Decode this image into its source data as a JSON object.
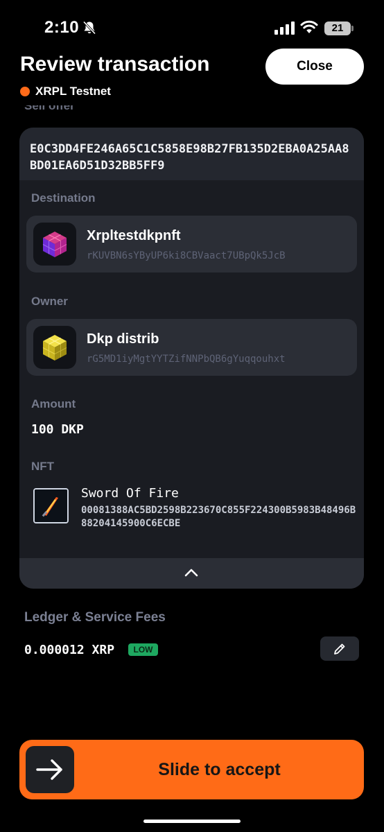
{
  "status_bar": {
    "time": "2:10",
    "battery": "21",
    "icons": [
      "bell-slash-icon",
      "signal-icon",
      "wifi-icon",
      "battery-icon"
    ]
  },
  "header": {
    "title": "Review transaction",
    "network": "XRPL Testnet",
    "network_color": "#ff6b1a",
    "close_label": "Close"
  },
  "sell_offer": {
    "label": "Sell offer",
    "id": "E0C3DD4FE246A65C1C5858E98B27FB135D2EBA0A25AA8BD01EA6D51D32BB5FF9"
  },
  "destination": {
    "label": "Destination",
    "name": "Xrpltestdkpnft",
    "address": "rKUVBN6sYByUP6ki8CBVaact7UBpQk5JcB"
  },
  "owner": {
    "label": "Owner",
    "name": "Dkp distrib",
    "address": "rG5MD1iyMgtYYTZifNNPbQB6gYuqqouhxt"
  },
  "amount": {
    "label": "Amount",
    "value": "100 DKP"
  },
  "nft": {
    "label": "NFT",
    "name": "Sword Of Fire",
    "token_id": "00081388AC5BD2598B223670C855F224300B5983B48496B88204145900C6ECBE"
  },
  "fees": {
    "label": "Ledger & Service Fees",
    "value": "0.000012 XRP",
    "badge": "LOW",
    "badge_color": "#1ea860"
  },
  "slider": {
    "label": "Slide to accept",
    "color": "#ff6b17"
  }
}
